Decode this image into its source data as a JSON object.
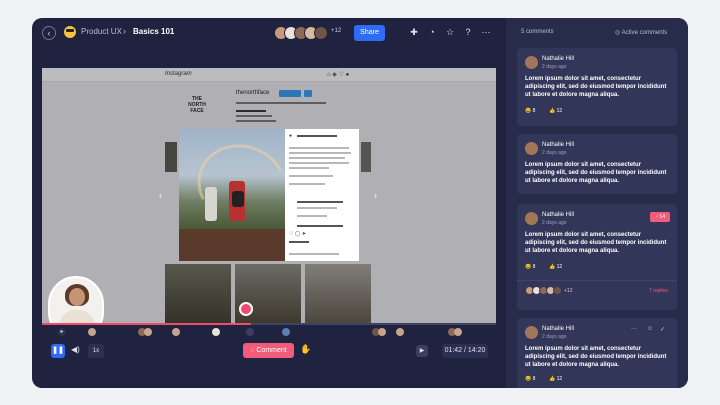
{
  "header": {
    "back_icon": "arrow-left-icon",
    "workspace_emoji": "sunglasses-emoji",
    "workspace": "Product UX",
    "separator": "›",
    "project": "Basics 101",
    "collaborators_more": "+12",
    "share_label": "Share",
    "icons": [
      "puzzle-icon",
      "bell-icon",
      "star-icon",
      "help-icon",
      "more-icon"
    ]
  },
  "player": {
    "speed": "1x",
    "comment_label": "Comment",
    "time": "01:42 / 14:20",
    "progress_fraction": 0.46
  },
  "comments_panel": {
    "count_label": "5 comments",
    "active_label": "Active comments",
    "comments": [
      {
        "author": "Nathalie Hill",
        "time": "2 days ago",
        "text": "Lorem ipsum dolor sit amet, consectetur adipiscing elit, sed do eiusmod tempor incididunt ut labore et dolore magna aliqua.",
        "laugh_count": "8",
        "thumbs_count": "12"
      },
      {
        "author": "Nathalie Hill",
        "time": "2 days ago",
        "text": "Lorem ipsum dolor sit amet, consectetur adipiscing elit, sed do eiusmod tempor incididunt ut labore et dolore magna aliqua."
      },
      {
        "author": "Nathalie Hill",
        "time": "2 days ago",
        "text": "Lorem ipsum dolor sit amet, consectetur adipiscing elit, sed do eiusmod tempor incididunt ut labore et dolore magna aliqua.",
        "laugh_count": "8",
        "thumbs_count": "12",
        "badge": "14",
        "more_participants": "+12",
        "replies": "7 replies"
      },
      {
        "author": "Nathalie Hill",
        "time": "2 days ago",
        "text": "Lorem ipsum dolor sit amet, consectetur adipiscing elit, sed do eiusmod tempor incididunt ut labore et dolore magna aliqua.",
        "laugh_count": "8",
        "thumbs_count": "12"
      }
    ]
  },
  "colors": {
    "accent_blue": "#2f6cf6",
    "accent_pink": "#f25c7b",
    "panel_bg": "#282c4b",
    "app_bg": "#1f2340"
  }
}
